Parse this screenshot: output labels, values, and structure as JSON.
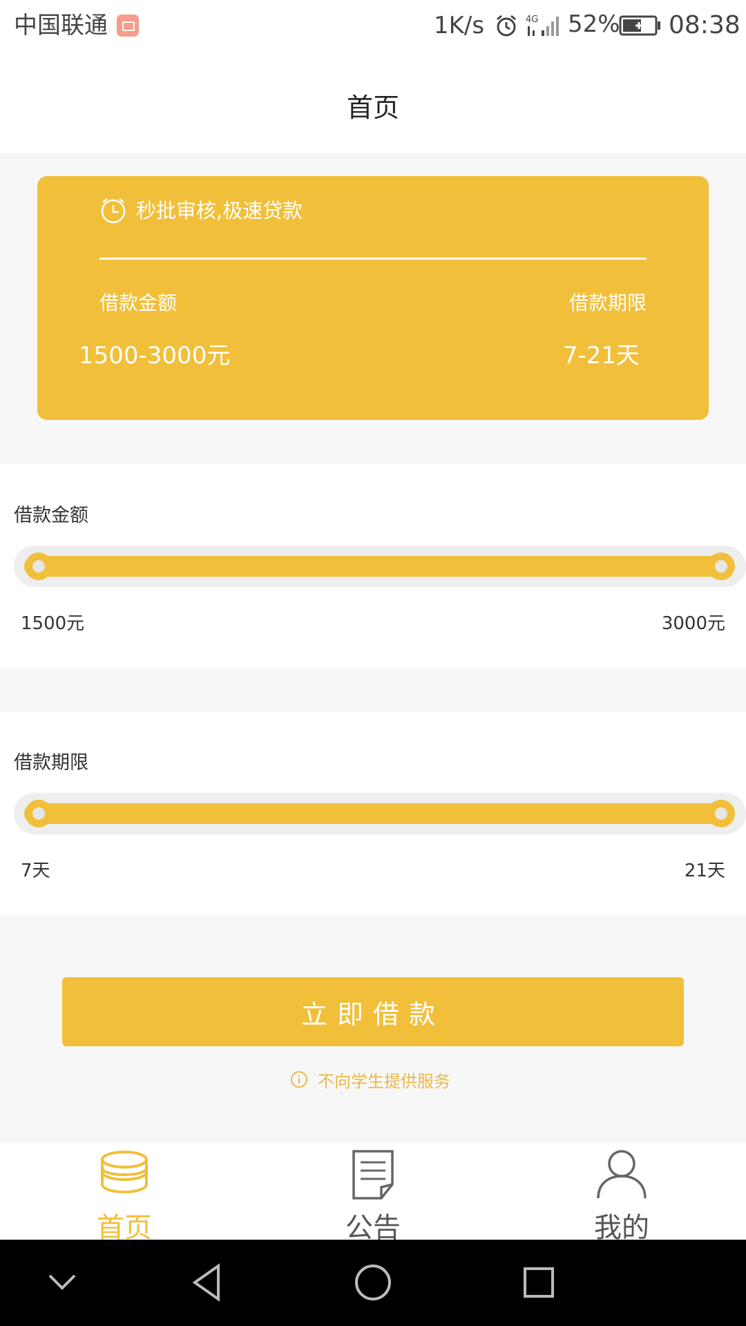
{
  "status_bar": {
    "carrier": "中国联通",
    "net_speed": "1K/s",
    "network_type": "4G",
    "battery_percent": "52%",
    "time": "08:38"
  },
  "header": {
    "title": "首页"
  },
  "hero": {
    "slogan": "秒批审核,极速贷款",
    "amount_label": "借款金额",
    "amount_value": "1500-3000元",
    "term_label": "借款期限",
    "term_value": "7-21天"
  },
  "amount_slider": {
    "label": "借款金额",
    "min_label": "1500元",
    "max_label": "3000元"
  },
  "term_slider": {
    "label": "借款期限",
    "min_label": "7天",
    "max_label": "21天"
  },
  "cta": {
    "label": "立即借款",
    "notice": "不向学生提供服务"
  },
  "tabbar": {
    "items": [
      {
        "label": "首页",
        "icon": "coins-stack-icon",
        "active": true
      },
      {
        "label": "公告",
        "icon": "document-icon",
        "active": false
      },
      {
        "label": "我的",
        "icon": "user-icon",
        "active": false
      }
    ]
  },
  "colors": {
    "accent": "#f1bf3a",
    "notice_text": "#e9b949",
    "tab_inactive": "#555555",
    "page_bg": "#f7f7f7"
  }
}
